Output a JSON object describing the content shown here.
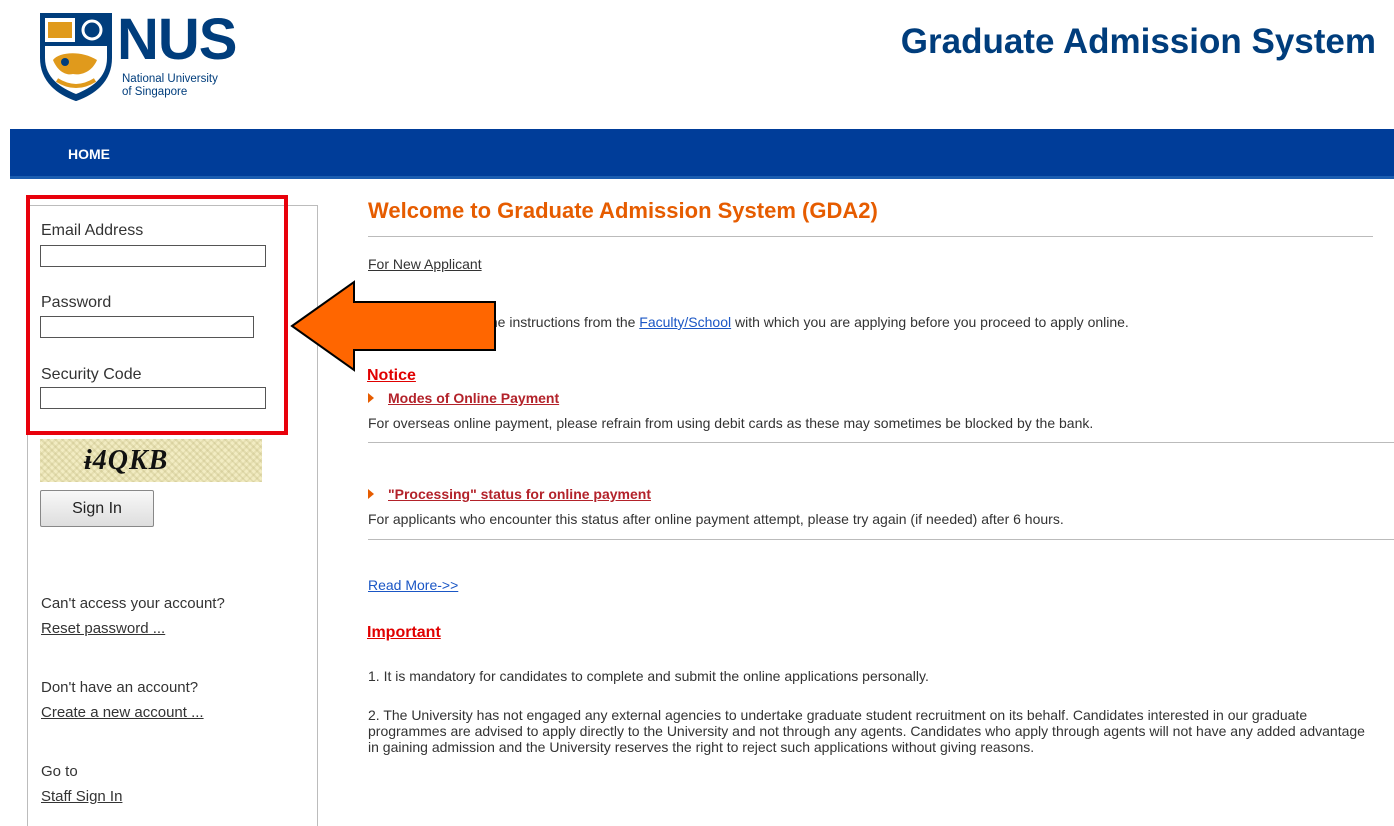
{
  "header": {
    "logo_name": "NUS",
    "logo_sub_1": "National University",
    "logo_sub_2": "of Singapore",
    "system_title": "Graduate Admission System"
  },
  "nav": {
    "home": "HOME"
  },
  "login": {
    "email_label": "Email Address",
    "email_value": "",
    "password_label": "Password",
    "password_value": "",
    "security_label": "Security Code",
    "security_value": "",
    "captcha": "ɨ4QKB",
    "signin": "Sign In"
  },
  "account": {
    "cant_access": "Can't access your account?",
    "reset": "Reset password ...",
    "no_account": "Don't have an account?",
    "create": "Create a new account ...",
    "goto": "Go to",
    "staff": "Staff Sign In"
  },
  "main": {
    "welcome": "Welcome to Graduate Admission System (GDA2)",
    "new_applicant": "For New Applicant",
    "instr_prefix": "the instructions from the ",
    "instr_link": "Faculty/School",
    "instr_suffix": " with which you are applying before you proceed to apply online.",
    "notice": "Notice",
    "n1_title": "Modes of Online Payment",
    "n1_text": "For overseas online payment, please refrain from using debit cards as these may sometimes be blocked by the bank.",
    "n2_title": "\"Processing\" status for online payment",
    "n2_text": "For applicants who encounter this status after online payment attempt, please try again (if needed) after 6 hours.",
    "read_more": "Read More->>",
    "important": "Important",
    "imp1": "1. It is mandatory for candidates to complete and submit the online applications personally.",
    "imp2": "2. The University has not engaged any external agencies to undertake graduate student recruitment on its behalf. Candidates interested in our graduate programmes are advised to apply directly to the University and not through any agents. Candidates who apply through agents will not have any added advantage in gaining admission and the University reserves the right to reject such applications without giving reasons."
  },
  "colors": {
    "brand_blue": "#003d7c",
    "nav_blue": "#003d99",
    "accent_orange": "#e65c00",
    "notice_red": "#e00000",
    "highlight_red": "#e8000b",
    "arrow_orange": "#ff6600"
  },
  "icons": {
    "logo": "nus-crest-icon",
    "bullet": "triangle-right-icon",
    "annotation": "arrow-left-icon"
  }
}
